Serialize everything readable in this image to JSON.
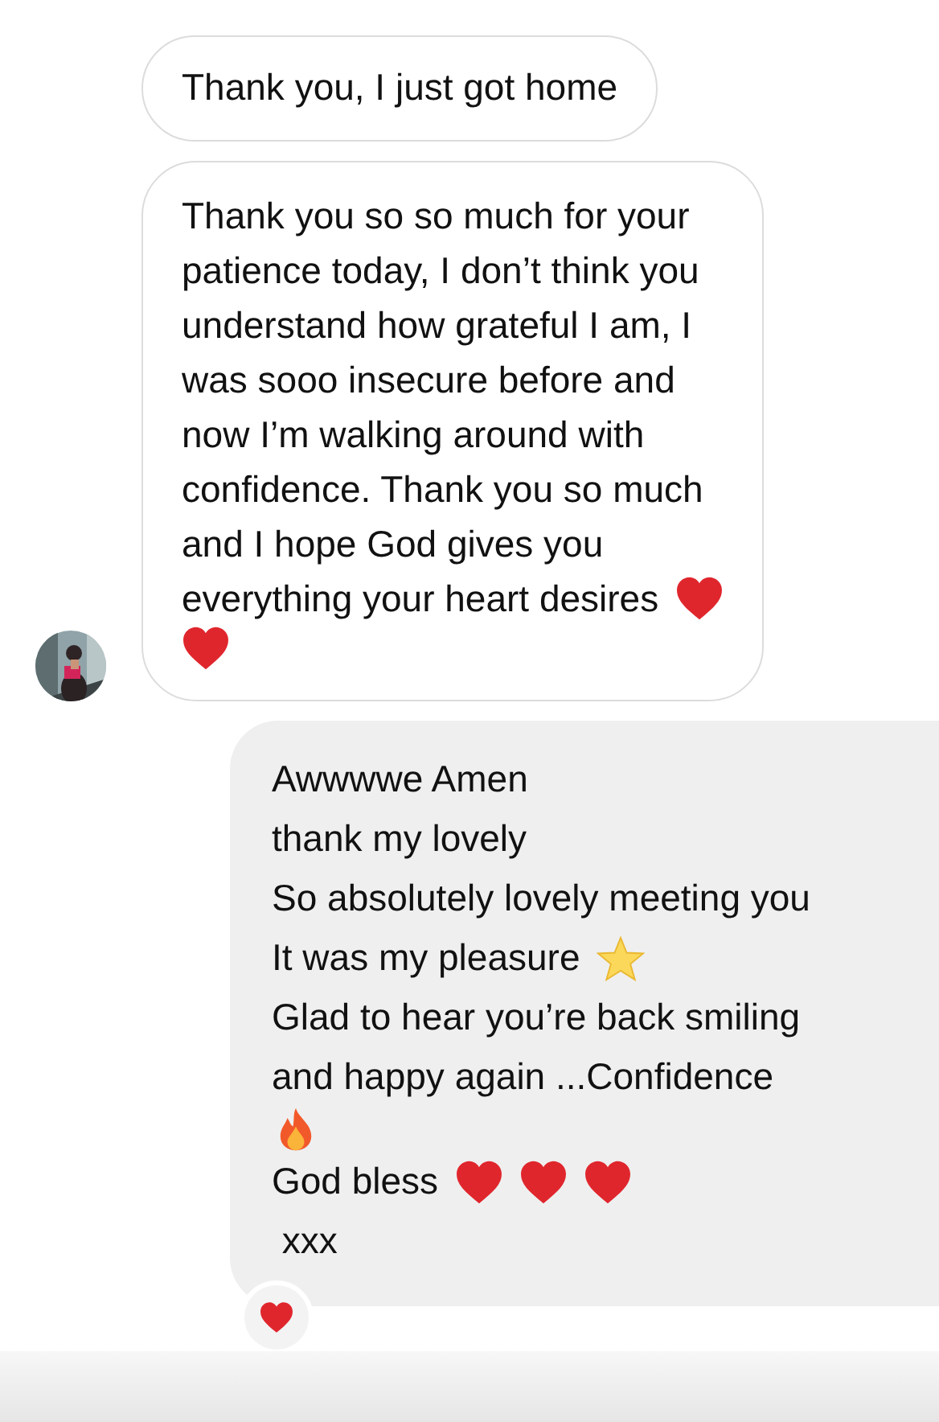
{
  "messages": [
    {
      "kind": "incoming",
      "avatar": false,
      "lines": [
        [
          {
            "kind": "text",
            "text": "Thank you, I just got home"
          }
        ]
      ]
    },
    {
      "kind": "incoming",
      "avatar": true,
      "lines": [
        [
          {
            "kind": "text",
            "text": "Thank you so so much for your"
          }
        ],
        [
          {
            "kind": "text",
            "text": "patience today, I don’t think you"
          }
        ],
        [
          {
            "kind": "text",
            "text": "understand how grateful I am, I"
          }
        ],
        [
          {
            "kind": "text",
            "text": "was sooo insecure before and"
          }
        ],
        [
          {
            "kind": "text",
            "text": "now I’m walking around with"
          }
        ],
        [
          {
            "kind": "text",
            "text": "confidence. Thank you so much"
          }
        ],
        [
          {
            "kind": "text",
            "text": "and I hope God gives you"
          }
        ],
        [
          {
            "kind": "text",
            "text": "everything your heart desires"
          },
          {
            "kind": "heart"
          }
        ],
        [
          {
            "kind": "heart"
          }
        ]
      ]
    },
    {
      "kind": "outgoing",
      "avatar": false,
      "reaction": {
        "kind": "heart"
      },
      "lines": [
        [
          {
            "kind": "text",
            "text": "Awwwwe Amen"
          }
        ],
        [
          {
            "kind": "text",
            "text": "thank my lovely"
          }
        ],
        [
          {
            "kind": "text",
            "text": "So absolutely lovely meeting you"
          }
        ],
        [
          {
            "kind": "text",
            "text": "It was my pleasure"
          },
          {
            "kind": "star"
          }
        ],
        [
          {
            "kind": "text",
            "text": "Glad to hear you’re back smiling"
          }
        ],
        [
          {
            "kind": "text",
            "text": "and happy again ...Confidence"
          }
        ],
        [
          {
            "kind": "fire"
          }
        ],
        [
          {
            "kind": "text",
            "text": "God bless"
          },
          {
            "kind": "heart"
          },
          {
            "kind": "heart"
          },
          {
            "kind": "heart"
          }
        ],
        [
          {
            "kind": "text",
            "text": " xxx"
          }
        ]
      ]
    }
  ]
}
